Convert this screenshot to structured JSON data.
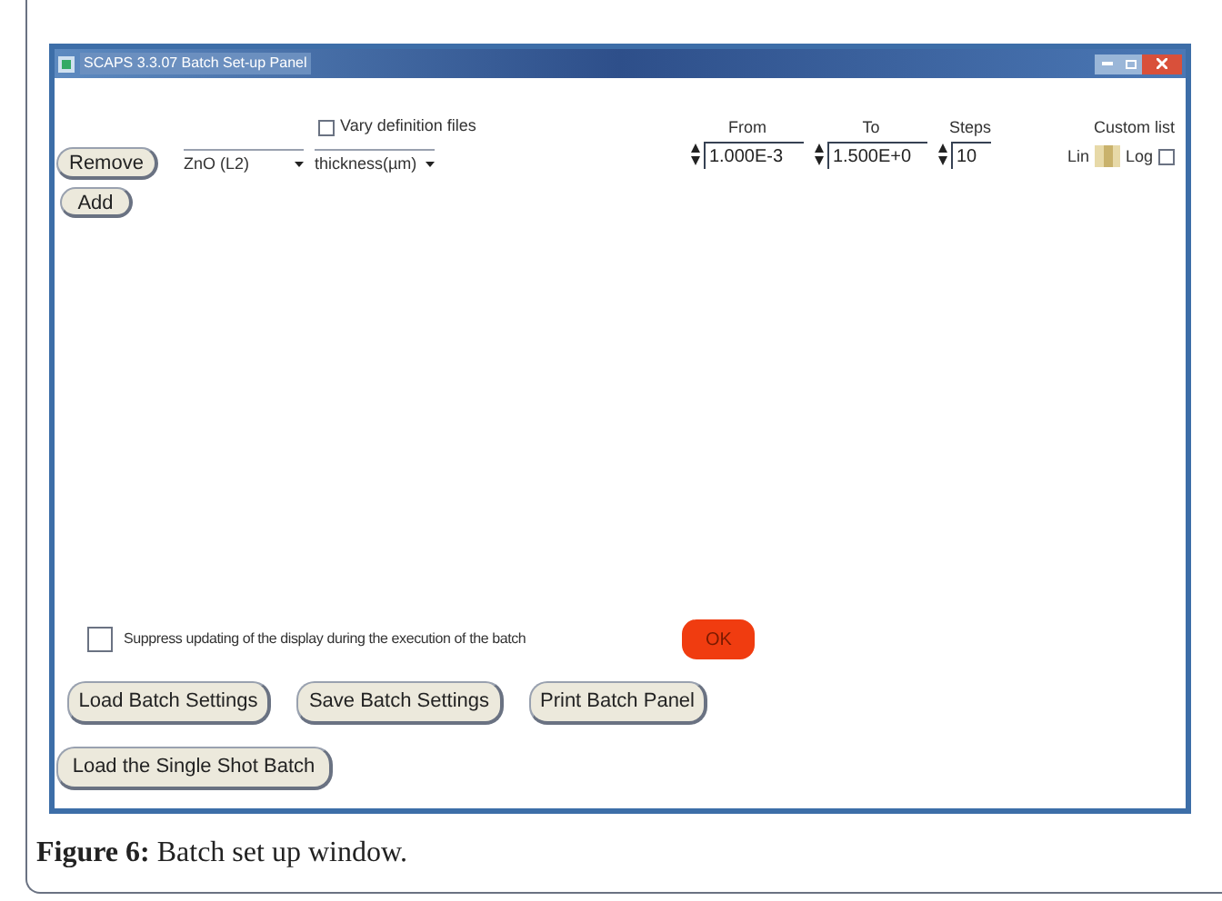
{
  "window": {
    "title": "SCAPS 3.3.07 Batch Set-up Panel"
  },
  "vary_definition_files": {
    "label": "Vary definition files",
    "checked": false
  },
  "row_buttons": [
    "Remove",
    "Add"
  ],
  "parameter": {
    "layer": "ZnO (L2)",
    "property": "thickness(µm)"
  },
  "range": [
    {
      "label": "From",
      "value": "1.000E-3"
    },
    {
      "label": "To",
      "value": "1.500E+0"
    },
    {
      "label": "Steps",
      "value": "10"
    }
  ],
  "scale": {
    "label": "Custom list",
    "lin": "Lin",
    "log": "Log",
    "custom_checked": false
  },
  "suppress": {
    "label": "Suppress updating of the display during the execution of the batch",
    "checked": false
  },
  "ok_button": "OK",
  "bottom_buttons": [
    "Load Batch Settings",
    "Save Batch Settings",
    "Print Batch Panel",
    "Load the Single Shot Batch"
  ],
  "caption": "**Figure 6:** Batch set up window."
}
